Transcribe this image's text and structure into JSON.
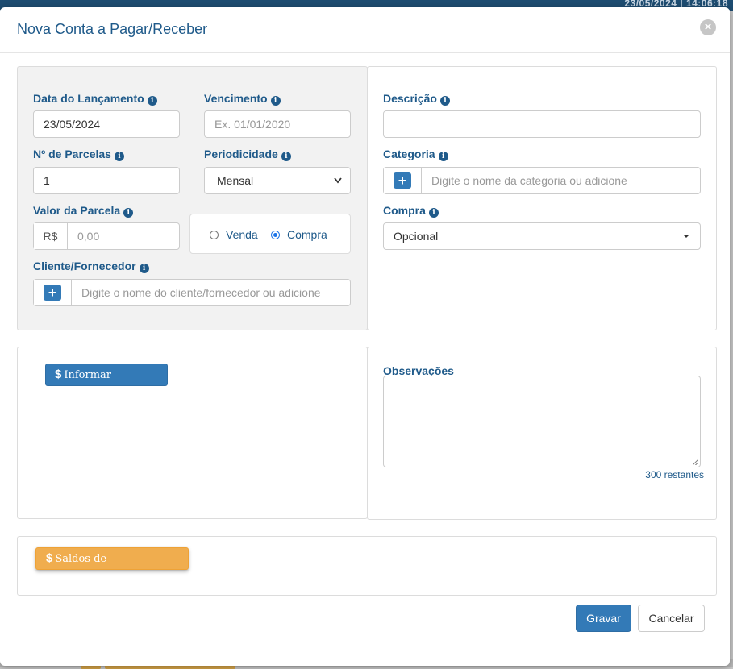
{
  "background": {
    "top_bar_text": "23/05/2024  |  14:06:18"
  },
  "modal": {
    "title": "Nova Conta a Pagar/Receber",
    "close_icon": "close-circle-icon"
  },
  "form": {
    "data_lancamento": {
      "label": "Data do Lançamento",
      "value": "23/05/2024"
    },
    "vencimento": {
      "label": "Vencimento",
      "placeholder": "Ex. 01/01/2020"
    },
    "num_parcelas": {
      "label": "Nº de Parcelas",
      "value": "1"
    },
    "periodicidade": {
      "label": "Periodicidade",
      "selected": "Mensal"
    },
    "valor_parcela": {
      "label": "Valor da Parcela",
      "prefix": "R$",
      "placeholder": "0,00"
    },
    "tipo": {
      "option_venda": "Venda",
      "option_compra": "Compra",
      "selected": "Compra"
    },
    "cliente": {
      "label": "Cliente/Fornecedor",
      "placeholder": "Digite o nome do cliente/fornecedor ou adicione"
    },
    "descricao": {
      "label": "Descrição",
      "value": ""
    },
    "categoria": {
      "label": "Categoria",
      "placeholder": "Digite o nome da categoria ou adicione"
    },
    "compra": {
      "label": "Compra",
      "selected": "Opcional"
    },
    "observacoes": {
      "label": "Observações",
      "counter": "300 restantes"
    }
  },
  "buttons": {
    "informar_pagamento": "Informar Pagamento",
    "saldos": "Saldos de Bancos/Carteiras",
    "gravar": "Gravar",
    "cancelar": "Cancelar"
  },
  "colors": {
    "primary": "#337ab7",
    "label": "#1f5a8a",
    "warning": "#f0ad4e"
  }
}
